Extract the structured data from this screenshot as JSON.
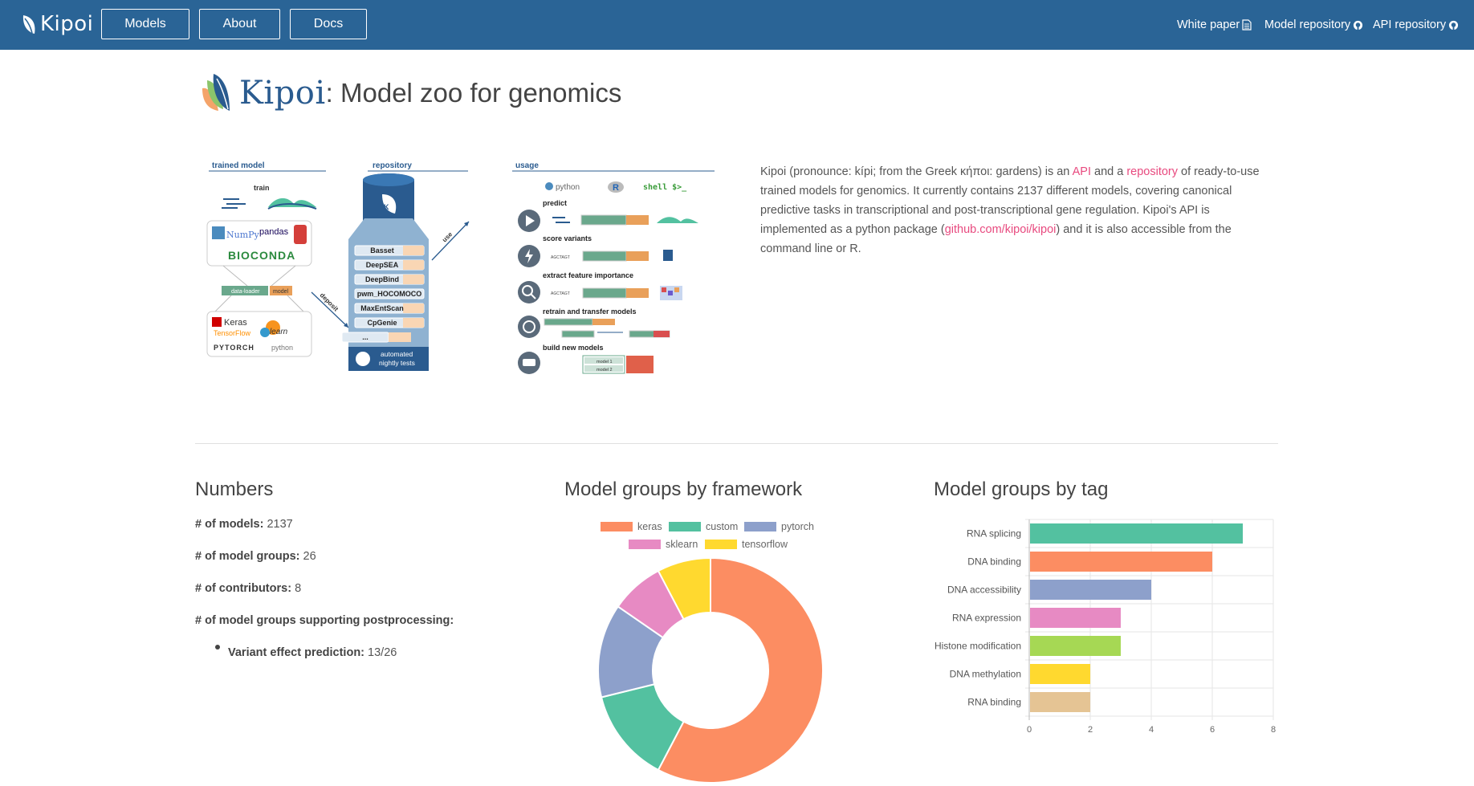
{
  "navbar": {
    "brand": "Kipoi",
    "buttons": [
      "Models",
      "About",
      "Docs"
    ],
    "links": [
      "White paper",
      "Model repository",
      "API repository"
    ]
  },
  "header": {
    "kipoi": "Kipoi",
    "title_rest": ": Model zoo for genomics"
  },
  "infographic": {
    "sections": [
      "trained model",
      "repository",
      "usage"
    ],
    "train_label": "train",
    "libs_top": [
      "NumPy",
      "pandas",
      "BIOCONDA"
    ],
    "dataloader": "data-loader",
    "model": "model",
    "deposit": "deposit",
    "use": "use",
    "libs_bottom": [
      "Keras",
      "TensorFlow",
      "learn",
      "PYTORCH",
      "python"
    ],
    "repo_models": [
      "Basset",
      "DeepSEA",
      "DeepBind",
      "pwm_HOCOMOCO",
      "MaxEntScan",
      "CpGenie",
      "..."
    ],
    "tests": [
      "automated",
      "nightly tests"
    ],
    "languages": [
      "python",
      "R",
      "shell $>_"
    ],
    "usage_items": [
      "predict",
      "score variants",
      "extract feature importance",
      "retrain and transfer models",
      "build new models"
    ],
    "model_boxes": [
      "model 1",
      "model 2"
    ],
    "seq": "AGCTAGT"
  },
  "intro": {
    "p1": "Kipoi (pronounce: kípi; from the Greek κήποι: gardens) is an ",
    "api": "API",
    "p2": " and a ",
    "repository": "repository",
    "p3": " of ready-to-use trained models for genomics. It currently contains 2137 different models, covering canonical predictive tasks in transcriptional and post-transcriptional gene regulation. Kipoi's API is implemented as a python package (",
    "github": "github.com/kipoi/kipoi",
    "p4": ") and it is also accessible from the command line or R."
  },
  "numbers": {
    "title": "Numbers",
    "models_label": "# of models:",
    "models": "2137",
    "groups_label": "# of model groups:",
    "groups": "26",
    "contributors_label": "# of contributors:",
    "contributors": "8",
    "postproc_label": "# of model groups supporting postprocessing:",
    "vep_label": "Variant effect prediction:",
    "vep": "13/26"
  },
  "framework": {
    "title": "Model groups by framework"
  },
  "tags": {
    "title": "Model groups by tag"
  },
  "chart_data": [
    {
      "type": "pie",
      "variant": "doughnut",
      "title": "Model groups by framework",
      "categories": [
        "keras",
        "custom",
        "pytorch",
        "sklearn",
        "tensorflow"
      ],
      "values": [
        15,
        3.5,
        3.5,
        2,
        2
      ],
      "colors": [
        "#fc8d62",
        "#53c1a0",
        "#8da0cb",
        "#e78ac3",
        "#ffd92f"
      ],
      "legend": "top"
    },
    {
      "type": "bar",
      "orientation": "horizontal",
      "title": "Model groups by tag",
      "categories": [
        "RNA splicing",
        "DNA binding",
        "DNA accessibility",
        "RNA expression",
        "Histone modification",
        "DNA methylation",
        "RNA binding"
      ],
      "values": [
        7,
        6,
        4,
        3,
        3,
        2,
        2
      ],
      "colors": [
        "#53c1a0",
        "#fc8d62",
        "#8da0cb",
        "#e78ac3",
        "#a6d854",
        "#ffd92f",
        "#e5c494"
      ],
      "xlim": [
        0,
        8
      ],
      "xticks": [
        "0",
        "2",
        "4",
        "6",
        "8"
      ],
      "grid": true
    }
  ]
}
